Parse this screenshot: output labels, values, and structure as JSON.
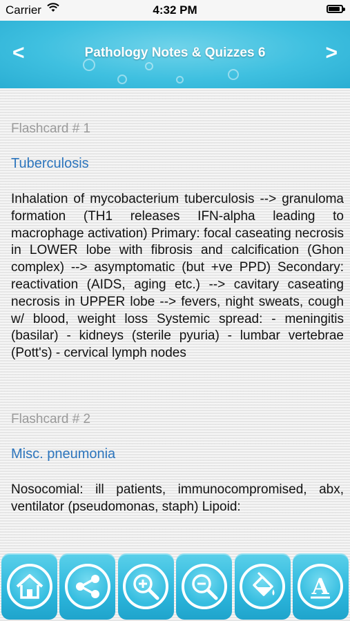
{
  "status_bar": {
    "carrier": "Carrier",
    "time": "4:32 PM",
    "battery_level": 0.9
  },
  "header": {
    "title": "Pathology Notes & Quizzes 6",
    "back_label": "<",
    "forward_label": ">"
  },
  "cards": [
    {
      "label": "Flashcard # 1",
      "title": "Tuberculosis",
      "body": "Inhalation of mycobacterium tuberculosis --> granuloma formation (TH1 releases IFN-alpha leading to macrophage activation) Primary: focal caseating necrosis in LOWER lobe with fibrosis and calcification (Ghon complex) --> asymptomatic (but +ve PPD) Secondary: reactivation (AIDS, aging etc.) --> cavitary caseating necrosis in UPPER lobe --> fevers, night sweats, cough w/ blood, weight loss Systemic spread: - meningitis (basilar) - kidneys (sterile pyuria) - lumbar vertebrae (Pott's) - cervical lymph nodes"
    },
    {
      "label": "Flashcard # 2",
      "title": "Misc. pneumonia",
      "body": "Nosocomial: ill patients, immunocompromised, abx, ventilator (pseudomonas, staph) Lipoid:"
    }
  ],
  "toolbar": {
    "font_button_letter": "A",
    "buttons": [
      {
        "icon": "home-icon"
      },
      {
        "icon": "share-icon"
      },
      {
        "icon": "zoom-in-icon"
      },
      {
        "icon": "zoom-out-icon"
      },
      {
        "icon": "paint-bucket-icon"
      },
      {
        "icon": "font-icon"
      }
    ]
  },
  "colors": {
    "header_accent": "#3fc0e0",
    "title_link": "#2c75bd",
    "label_gray": "#9a9a9a"
  }
}
